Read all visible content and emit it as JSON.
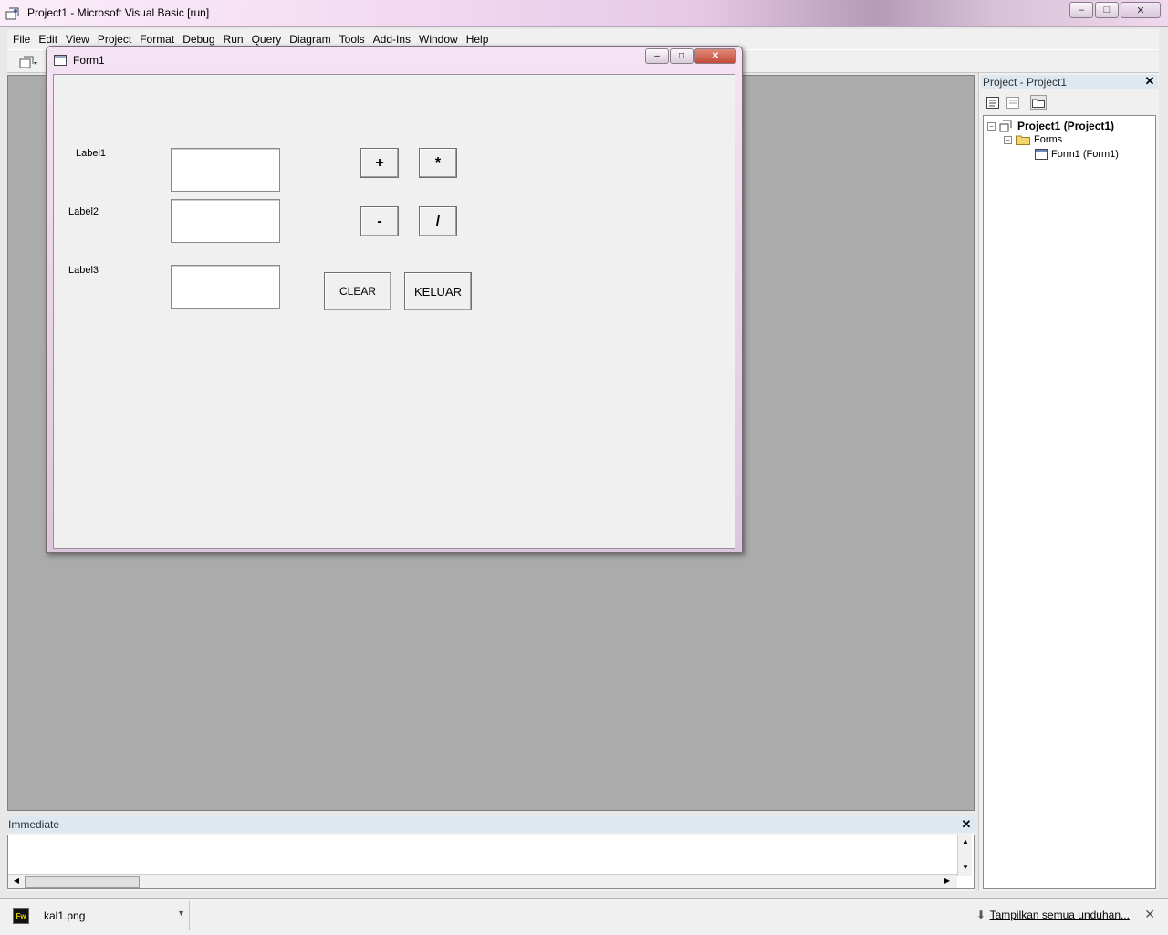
{
  "window": {
    "title": "Project1 - Microsoft Visual Basic [run]",
    "min_icon": "minimize-icon",
    "max_icon": "maximize-icon",
    "close_icon": "close-icon",
    "min_glyph": "–",
    "max_glyph": "□",
    "close_glyph": "✕"
  },
  "menu": [
    {
      "label": "File"
    },
    {
      "label": "Edit"
    },
    {
      "label": "View"
    },
    {
      "label": "Project"
    },
    {
      "label": "Format"
    },
    {
      "label": "Debug"
    },
    {
      "label": "Run"
    },
    {
      "label": "Query"
    },
    {
      "label": "Diagram"
    },
    {
      "label": "Tools"
    },
    {
      "label": "Add-Ins"
    },
    {
      "label": "Window"
    },
    {
      "label": "Help"
    }
  ],
  "form1": {
    "title": "Form1",
    "min_glyph": "–",
    "max_glyph": "□",
    "close_glyph": "✕",
    "labels": [
      "Label1",
      "Label2",
      "Label3"
    ],
    "buttons": {
      "add": "+",
      "multiply": "*",
      "subtract": "-",
      "divide": "/",
      "clear": "CLEAR",
      "exit": "KELUAR"
    }
  },
  "project_panel": {
    "title": "Project - Project1",
    "close_glyph": "✕",
    "tree": {
      "root": "Project1 (Project1)",
      "folder": "Forms",
      "item": "Form1 (Form1)"
    }
  },
  "immediate": {
    "title": "Immediate",
    "close_glyph": "✕"
  },
  "download_bar": {
    "file_name": "kal1.png",
    "file_badge": "Fw",
    "show_all": "Tampilkan semua unduhan...",
    "close_glyph": "✕"
  },
  "colors": {
    "titlebar_pink": "#f1d6ef",
    "mdi_background": "#ababab",
    "panel_header": "#dde8f0"
  }
}
